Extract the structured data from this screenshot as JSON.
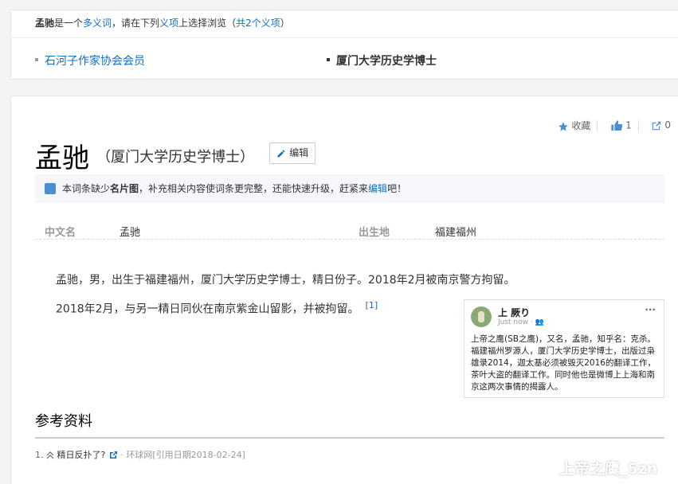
{
  "polysemy": {
    "lead_term": "孟驰",
    "lead_text_1": "是一个",
    "lead_link": "多义词",
    "lead_text_2": "，请在下列",
    "lead_link_2": "义项",
    "lead_text_3": "上选择浏览（",
    "lead_count": "共2个义项",
    "lead_text_4": "）",
    "items": [
      {
        "label": "石河子作家协会会员"
      },
      {
        "label": "厦门大学历史学博士"
      }
    ]
  },
  "tools": {
    "collect_label": "收藏",
    "like_count": "1",
    "share_count": "0"
  },
  "lemma": {
    "title": "孟驰",
    "subtitle": "（厦门大学历史学博士）",
    "edit_label": "编辑"
  },
  "tip": {
    "text_1": "本词条缺少",
    "bold": "名片图",
    "text_2": "，补充相关内容使词条更完整，还能快速升级，赶紧来",
    "link": "编辑",
    "text_3": "吧！"
  },
  "basic_info": [
    {
      "name": "中文名",
      "value": "孟驰"
    },
    {
      "name": "出生地",
      "value": "福建福州"
    }
  ],
  "paragraphs": [
    {
      "text": "孟驰，男，出生于福建福州，厦门大学历史学博士，精日份子。2018年2月被南京警方拘留。",
      "ref": ""
    },
    {
      "text": "2018年2月，与另一精日同伙在南京紫金山留影，并被拘留。",
      "ref": "[1]"
    }
  ],
  "picture_post": {
    "name": "上 厥り",
    "meta": "Just now · ",
    "more": "···",
    "text": "上帝之鹰(SB之鹰)，又名，孟驰，知乎名：克杀。福建福州罗源人，厦门大学历史学博士，出版过枭雄录2014，迦太基必须被毁灭2016的翻译工作，茶叶大盗的翻译工作。同时他也是微博上上海和南京这两次事情的揭露人。"
  },
  "references": {
    "title": "参考资料",
    "items": [
      {
        "num": "1.",
        "text": "精日反扑了?",
        "source": "环球网[引用日期2018-02-24]"
      }
    ]
  },
  "watermark": {
    "text": "上帝之鹰_5zn"
  },
  "colors": {
    "link": "#136ec2",
    "accent": "#4a8fd6"
  }
}
